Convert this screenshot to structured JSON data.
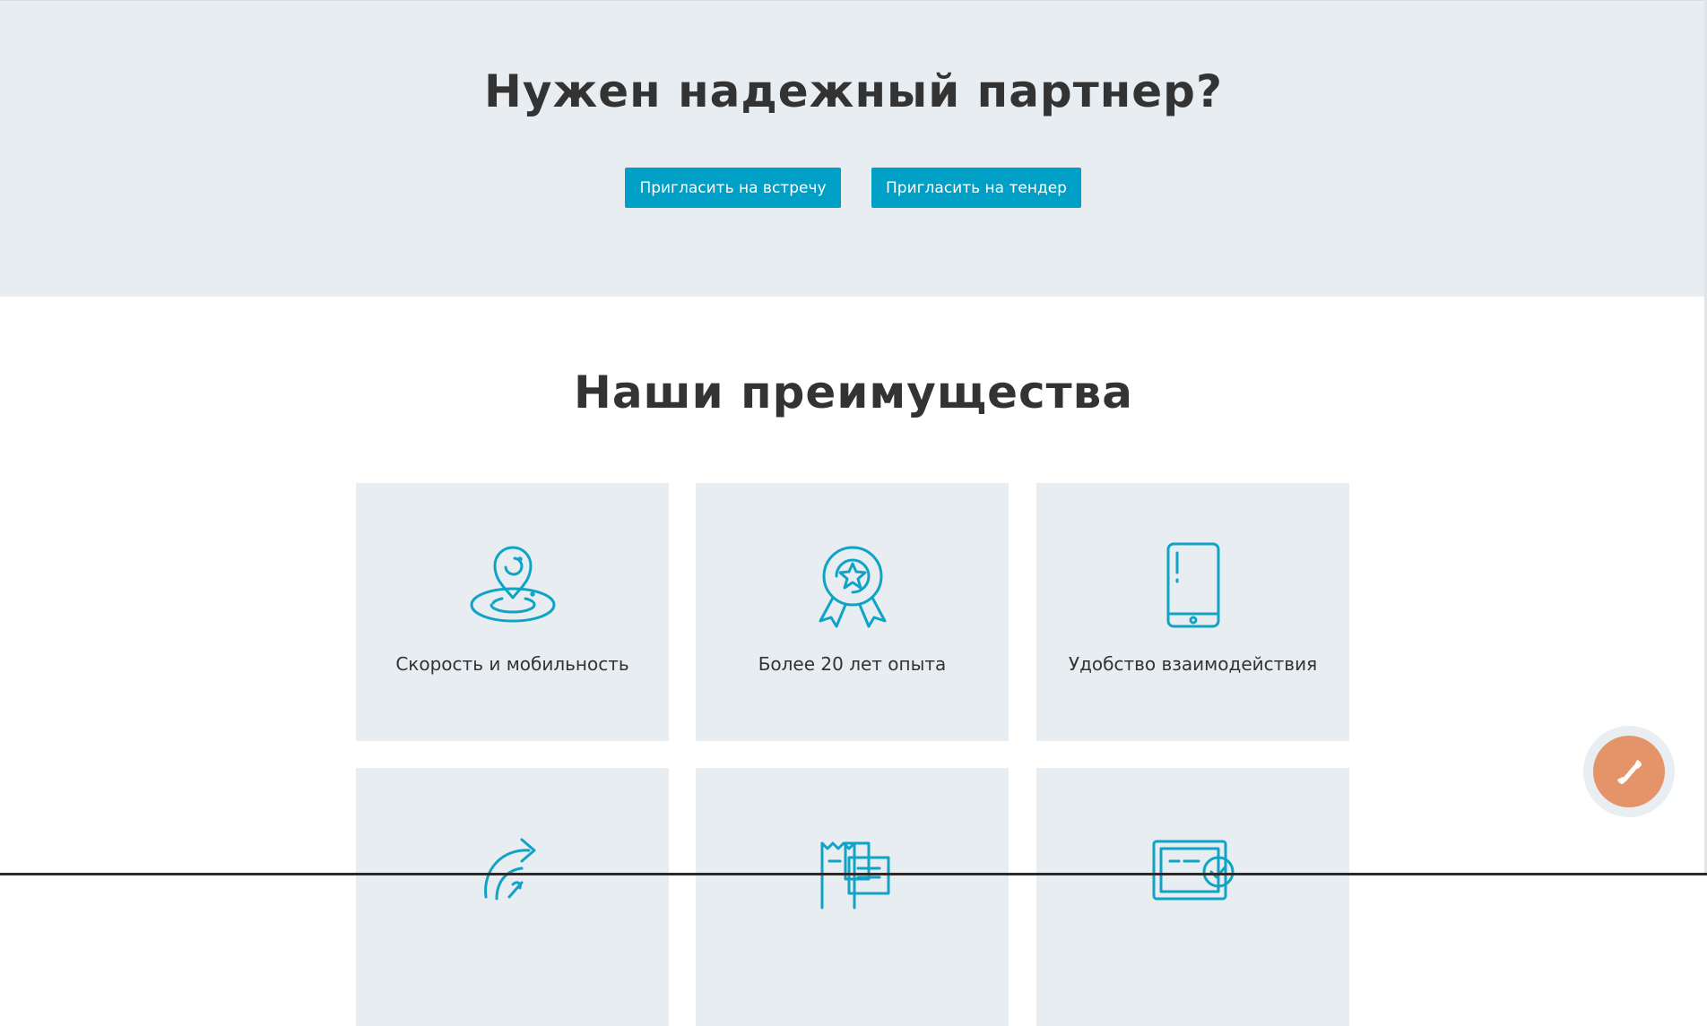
{
  "hero": {
    "title": "Нужен надежный партнер?",
    "buttons": {
      "meeting": "Пригласить на встречу",
      "tender": "Пригласить на тендер"
    }
  },
  "advantages": {
    "title": "Наши преимущества",
    "items": [
      {
        "icon": "location-pin-icon",
        "label": "Скорость и мобильность"
      },
      {
        "icon": "award-ribbon-icon",
        "label": "Более 20 лет опыта"
      },
      {
        "icon": "smartphone-icon",
        "label": "Удобство взаимодействия"
      },
      {
        "icon": "refresh-arrow-icon",
        "label": ""
      },
      {
        "icon": "documents-icon",
        "label": ""
      },
      {
        "icon": "certificate-icon",
        "label": ""
      }
    ]
  },
  "call_widget": {
    "icon": "phone-icon"
  },
  "colors": {
    "accent": "#009fc6",
    "section_bg": "#e7edf1",
    "call_button": "#e59469",
    "text": "#333333"
  }
}
